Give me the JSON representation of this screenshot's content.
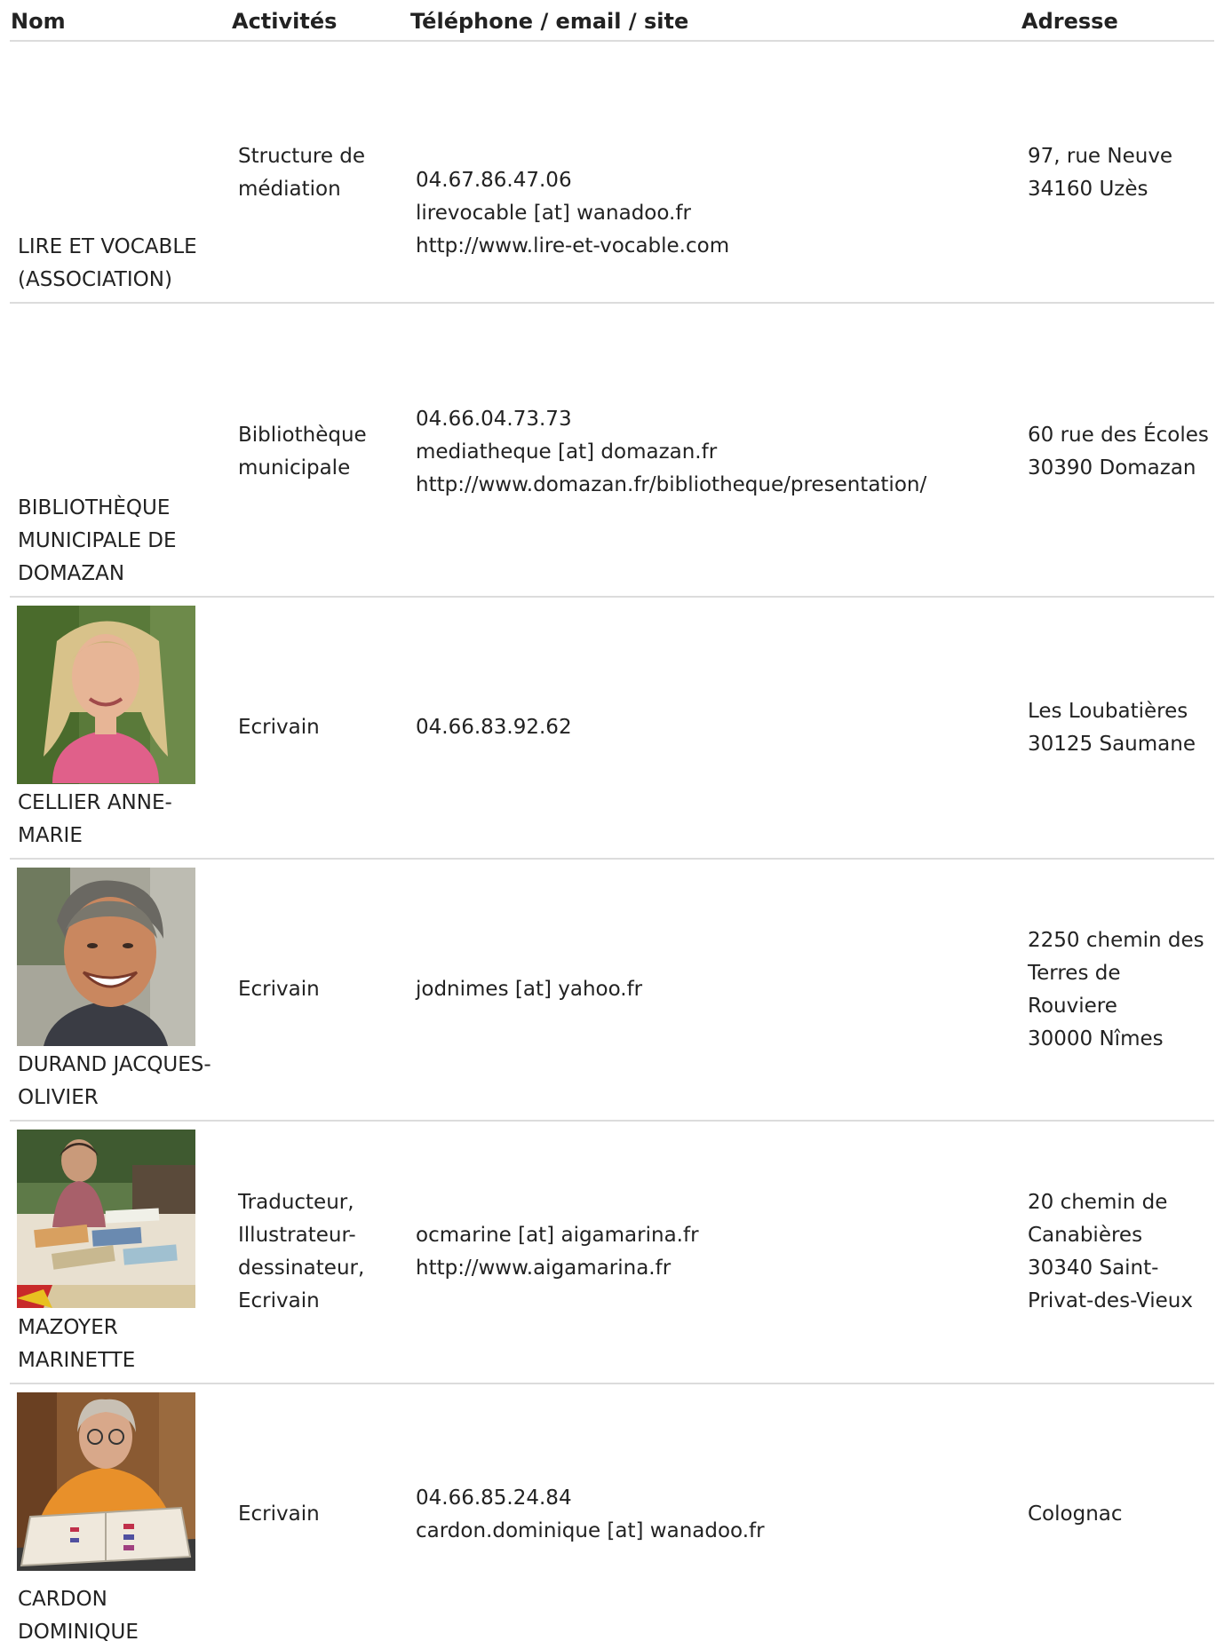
{
  "header": {
    "nom": "Nom",
    "activites": "Activités",
    "contact": "Téléphone / email / site",
    "adresse": "Adresse"
  },
  "rows": [
    {
      "name": [
        "LIRE ET VOCABLE",
        "(ASSOCIATION)"
      ],
      "activity": [
        "Structure de",
        "médiation"
      ],
      "contact": [
        "04.67.86.47.06",
        "lirevocable [at] wanadoo.fr",
        "http://www.lire-et-vocable.com"
      ],
      "address": [
        "97, rue Neuve",
        "34160 Uzès"
      ]
    },
    {
      "name": [
        "BIBLIOTHÈQUE",
        "MUNICIPALE DE",
        "DOMAZAN"
      ],
      "activity": [
        "Bibliothèque",
        "municipale"
      ],
      "contact": [
        "04.66.04.73.73",
        "mediatheque [at] domazan.fr",
        "http://www.domazan.fr/bibliotheque/presentation/"
      ],
      "address": [
        "60 rue des Écoles",
        "30390 Domazan"
      ]
    },
    {
      "name": [
        "CELLIER ANNE-",
        "MARIE"
      ],
      "photo": "portrait-blonde-woman",
      "activity": [
        "Ecrivain"
      ],
      "contact": [
        "04.66.83.92.62"
      ],
      "address": [
        "Les Loubatières",
        "30125 Saumane"
      ]
    },
    {
      "name": [
        "DURAND JACQUES-",
        "OLIVIER"
      ],
      "photo": "portrait-smiling-man",
      "activity": [
        "Ecrivain"
      ],
      "contact": [
        "jodnimes [at] yahoo.fr"
      ],
      "address": [
        "2250 chemin des",
        "Terres de",
        "Rouviere",
        "30000 Nîmes"
      ]
    },
    {
      "name": [
        "MAZOYER",
        "MARINETTE"
      ],
      "photo": "woman-at-book-stand",
      "activity": [
        "Traducteur,",
        "Illustrateur-",
        "dessinateur,",
        "Ecrivain"
      ],
      "contact": [
        "ocmarine [at] aigamarina.fr",
        "http://www.aigamarina.fr"
      ],
      "address": [
        "20 chemin de",
        "Canabières",
        "30340 Saint-",
        "Privat-des-Vieux"
      ]
    },
    {
      "name": [
        "CARDON",
        "DOMINIQUE"
      ],
      "photo": "woman-with-book",
      "activity": [
        "Ecrivain"
      ],
      "contact": [
        "04.66.85.24.84",
        "cardon.dominique [at] wanadoo.fr"
      ],
      "address": [
        "Colognac"
      ]
    }
  ]
}
